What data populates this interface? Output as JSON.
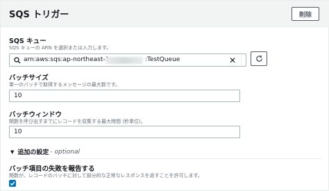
{
  "panel": {
    "title": "SQS トリガー",
    "delete_label": "削除"
  },
  "sqs_queue": {
    "label": "SQS キュー",
    "description": "SQS キューの ARN を選択または入力します。",
    "value_prefix": "arn:aws:sqs:ap-northeast-1:",
    "value_suffix": ":TestQueue",
    "clear_icon": "close-icon",
    "refresh_icon": "refresh-icon"
  },
  "batch_size": {
    "label": "バッチサイズ",
    "description": "単一のバッチで取得するメッセージの最大数です。",
    "value": "10"
  },
  "batch_window": {
    "label": "バッチウィンドウ",
    "description": "関数を呼び出すまでにレコードを収集する最大時間 (秒単位)。",
    "value": "10"
  },
  "additional_settings": {
    "label": "追加の設定",
    "optional": "- optional",
    "expanded": true
  },
  "report_batch_failures": {
    "label": "バッチ項目の失敗を報告する",
    "description": "関数が、レコードのバッチに対して部分的な正常なレスポンスを返すことを許可します。",
    "checked": true
  },
  "colors": {
    "accent": "#0073bb",
    "header_bg": "#f2f3f3",
    "border": "#aab7b8"
  }
}
